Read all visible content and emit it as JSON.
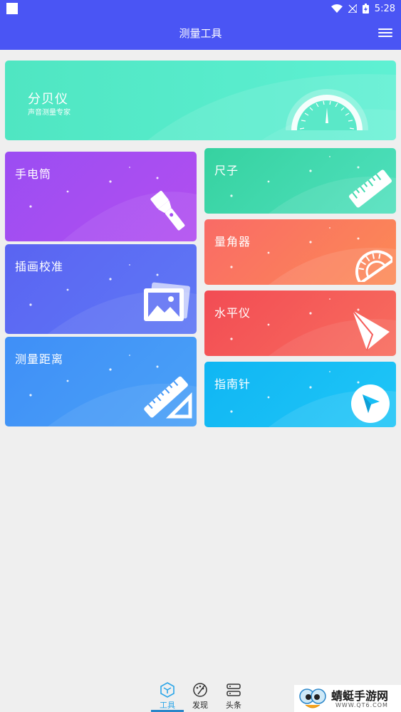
{
  "status_bar": {
    "time": "5:28"
  },
  "app_bar": {
    "title": "测量工具",
    "menu_icon": "hamburger-menu-icon"
  },
  "banner": {
    "title": "分贝仪",
    "subtitle": "声音测量专家",
    "icon": "decibel-gauge-icon"
  },
  "tools_left": [
    {
      "label": "手电筒",
      "icon": "flashlight-icon",
      "color": "#a64ef1"
    },
    {
      "label": "插画校准",
      "icon": "picture-icon",
      "color": "#5c6cf3"
    },
    {
      "label": "测量距离",
      "icon": "set-square-ruler-icon",
      "color": "#4598f7"
    }
  ],
  "tools_right": [
    {
      "label": "尺子",
      "icon": "ruler-icon",
      "color": "#40d9ae"
    },
    {
      "label": "量角器",
      "icon": "protractor-icon",
      "color": "#fa7a5d"
    },
    {
      "label": "水平仪",
      "icon": "paper-plane-icon",
      "color": "#f55b58"
    },
    {
      "label": "指南针",
      "icon": "compass-icon",
      "color": "#17bef5"
    }
  ],
  "bottom_nav": [
    {
      "label": "工具",
      "icon": "tool-cube-icon",
      "active": true
    },
    {
      "label": "发现",
      "icon": "discover-palette-icon",
      "active": false
    },
    {
      "label": "头条",
      "icon": "headlines-list-icon",
      "active": false
    }
  ],
  "watermark": {
    "title": "蜻蜓手游网",
    "url": "WWW.QT6.COM"
  },
  "colors": {
    "primary": "#4a55f4",
    "background": "#efefef",
    "nav_active": "#2aa5e8"
  }
}
